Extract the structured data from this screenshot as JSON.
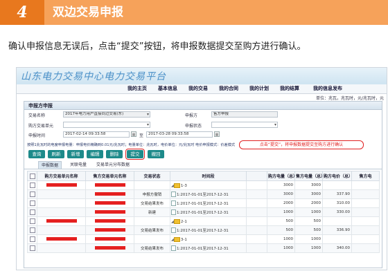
{
  "step": {
    "number": "4",
    "title": "双边交易申报"
  },
  "instruction": "确认申报信息无误后，点击“提交”按钮，将申报数据提交至购方进行确认。",
  "app": {
    "platform_title": "山东电力交易中心电力交易平台",
    "nav": [
      "我的主页",
      "基本信息",
      "我的交易",
      "我的合同",
      "我的计划",
      "我的结算",
      "我的信息发布"
    ],
    "unit_info": "单位：兆瓦，兆瓦时，元/兆瓦时，元"
  },
  "panel": {
    "title": "申报方申报",
    "form": {
      "trade_name_label": "交易名称",
      "trade_name_value": "2017年电力用户直接同过交易(东)",
      "declarer_label": "申报方",
      "declarer_value": "售方申报",
      "buyer_unit_label": "购方交易单元",
      "buyer_unit_value": "",
      "declare_status_label": "申报状态",
      "declare_status_value": "",
      "declare_time_label": "申报时间",
      "time_start": "2017-02-14 09:33:58",
      "time_separator": "至",
      "time_end": "2017-03-28 09:33:58"
    },
    "info_line": "按照1兆瓦时的电度申报电量：申报电价精确到0.01元/兆瓦时；电量单位：兆瓦时，电价单位：元/兆瓦时    电价申报模式：价差模式",
    "callout": "点击“提交”，将申报数据提交至购方进行确认",
    "buttons": [
      "查询",
      "刷新",
      "新增",
      "编辑",
      "删除",
      "提交",
      "撤回"
    ],
    "tabs": [
      "申报数据",
      "关联电量",
      "交易单元分布数据"
    ],
    "table": {
      "headers": [
        "",
        "购方交易单元名称",
        "售方交易单元名称",
        "交易状态",
        "时间段",
        "",
        "购方电量（总）",
        "售方电量（总）",
        "购方电价（总）",
        "售方电"
      ],
      "rows": [
        {
          "buyer": "",
          "seller": "",
          "status": "",
          "period": "1-3",
          "type": "folder",
          "bq": "3000",
          "sq": "3000",
          "bp": "",
          "sp": ""
        },
        {
          "buyer": "",
          "seller": "",
          "status": "申报方撤销",
          "period": "1:2017-01-01至2017-12-31",
          "type": "file",
          "bq": "3000",
          "sq": "3000",
          "bp": "337.90",
          "sp": ""
        },
        {
          "buyer": "",
          "seller": "",
          "status": "交易结果发布",
          "period": "1:2017-01-01至2017-12-31",
          "type": "file",
          "bq": "2000",
          "sq": "2000",
          "bp": "310.00",
          "sp": ""
        },
        {
          "buyer": "",
          "seller": "",
          "status": "新建",
          "period": "1:2017-01-01至2017-12-31",
          "type": "file",
          "bq": "1000",
          "sq": "1000",
          "bp": "330.00",
          "sp": ""
        },
        {
          "buyer": "",
          "seller": "",
          "status": "",
          "period": "2-1",
          "type": "folder",
          "bq": "500",
          "sq": "500",
          "bp": "",
          "sp": ""
        },
        {
          "buyer": "",
          "seller": "",
          "status": "交易结果发布",
          "period": "1:2017-01-01至2017-12-31",
          "type": "file",
          "bq": "500",
          "sq": "500",
          "bp": "336.90",
          "sp": ""
        },
        {
          "buyer": "",
          "seller": "",
          "status": "",
          "period": "3-1",
          "type": "folder",
          "bq": "1000",
          "sq": "1000",
          "bp": "",
          "sp": ""
        },
        {
          "buyer": "",
          "seller": "",
          "status": "交易结果发布",
          "period": "1:2017-01-01至2017-12-31",
          "type": "file",
          "bq": "1000",
          "sq": "1000",
          "bp": "340.00",
          "sp": ""
        }
      ]
    }
  }
}
